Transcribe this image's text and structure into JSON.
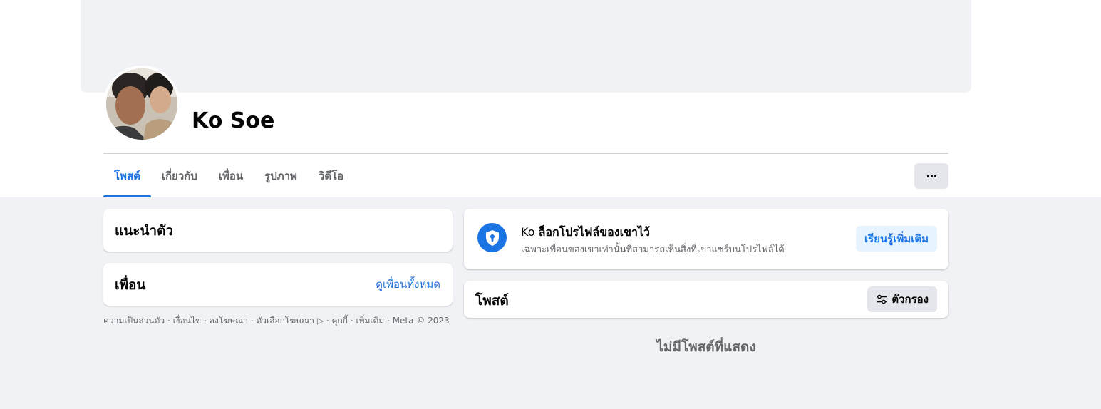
{
  "profile": {
    "name": "Ko Soe",
    "avatar_alt": "profile-photo"
  },
  "tabs": [
    {
      "label": "โพสต์",
      "active": true
    },
    {
      "label": "เกี่ยวกับ",
      "active": false
    },
    {
      "label": "เพื่อน",
      "active": false
    },
    {
      "label": "รูปภาพ",
      "active": false
    },
    {
      "label": "วิดีโอ",
      "active": false
    }
  ],
  "more_button": {
    "label": "···"
  },
  "intro": {
    "title": "แนะนำตัว"
  },
  "friends": {
    "title": "เพื่อน",
    "see_all": "ดูเพื่อนทั้งหมด"
  },
  "footer": {
    "text": "ความเป็นส่วนตัว · เงื่อนไข · ลงโฆษณา · ตัวเลือกโฆษณา ▷ · คุกกี้ · เพิ่มเติม · Meta © 2023"
  },
  "locked": {
    "first_name": "Ko",
    "title_rest": "ล็อกโปรไฟล์ของเขาไว้",
    "subtitle": "เฉพาะเพื่อนของเขาเท่านั้นที่สามารถเห็นสิ่งที่เขาแชร์บนโปรไฟล์ได้",
    "learn_more": "เรียนรู้เพิ่มเติม",
    "icon": "shield-lock-icon"
  },
  "posts": {
    "title": "โพสต์",
    "filter_label": "ตัวกรอง",
    "filter_icon": "filter-sliders-icon",
    "empty_text": "ไม่มีโพสต์ที่แสดง"
  },
  "colors": {
    "accent": "#1b74e4",
    "background": "#f0f2f5",
    "card": "#ffffff",
    "secondary_text": "#65676b"
  }
}
